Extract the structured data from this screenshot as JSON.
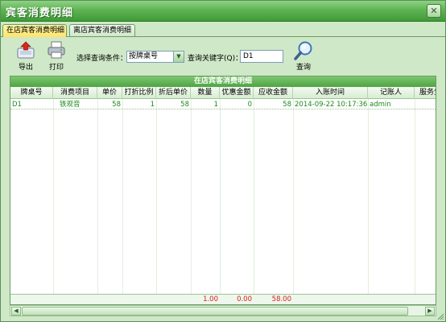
{
  "window": {
    "title": "宾客消费明细",
    "close_symbol": "✕"
  },
  "tabs": [
    {
      "label": "在店宾客消费明细",
      "active": true
    },
    {
      "label": "离店宾客消费明细",
      "active": false
    }
  ],
  "toolbar": {
    "export_label": "导出",
    "print_label": "打印",
    "condition_label": "选择查询条件：",
    "condition_value": "按牌桌号",
    "keyword_label": "查询关键字(Q)：",
    "keyword_value": "D1",
    "search_label": "查询"
  },
  "grid": {
    "caption": "在店宾客消费明细",
    "columns": [
      "牌桌号",
      "消费项目",
      "单价",
      "打折比例",
      "折后单价",
      "数量",
      "优惠金额",
      "应收金额",
      "入账时间",
      "记账人",
      "服务生"
    ],
    "rows": [
      {
        "table": "D1",
        "item": "铁观音",
        "price": "58",
        "discount": "1",
        "net_price": "58",
        "qty": "1",
        "off": "0",
        "due": "58",
        "time": "2014-09-22 10:17:36",
        "clerk": "admin",
        "waiter": ""
      }
    ],
    "footer": {
      "qty_total": "1.00",
      "off_total": "0.00",
      "due_total": "58.00"
    }
  },
  "colors": {
    "titlebar": "#5fb353",
    "caption": "#4ea443",
    "row_text": "#1d8a1d",
    "total_text": "#d62020",
    "active_tab": "#ffe46a"
  },
  "icons": [
    "export-icon",
    "print-icon",
    "magnifier-icon",
    "dropdown-arrow-icon"
  ]
}
